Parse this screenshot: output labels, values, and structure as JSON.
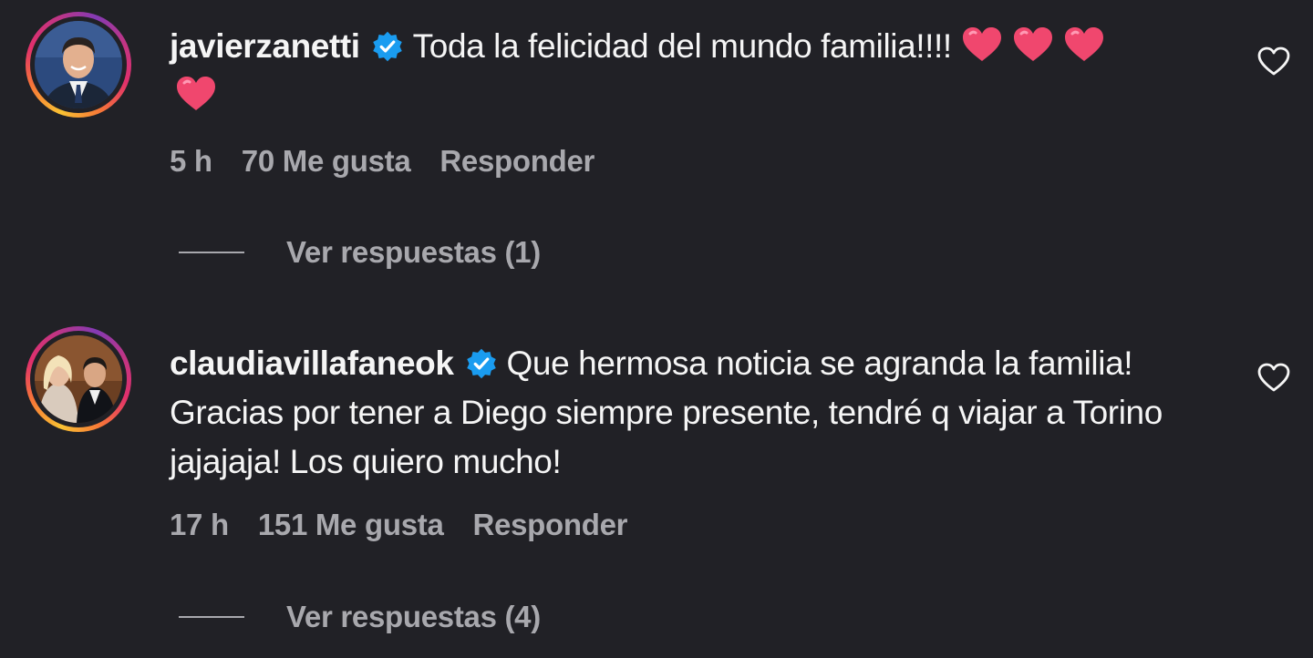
{
  "comments": [
    {
      "username": "javierzanetti",
      "text": "Toda la felicidad del mundo familia!!!!",
      "emoji_icons": [
        "heart-emoji",
        "heart-emoji",
        "heart-emoji",
        "heart-emoji"
      ],
      "time": "5 h",
      "likes": "70 Me gusta",
      "reply_label": "Responder",
      "view_replies": "Ver respuestas (1)",
      "avatar_icon": "avatar-photo-man-in-suit"
    },
    {
      "username": "claudiavillafaneok",
      "text": "Que hermosa noticia se agranda la familia! Gracias por tener a Diego siempre presente, tendré q viajar a Torino jajajaja! Los quiero mucho!",
      "time": "17 h",
      "likes": "151 Me gusta",
      "reply_label": "Responder",
      "view_replies": "Ver respuestas (4)",
      "avatar_icon": "avatar-photo-couple"
    }
  ],
  "icons": {
    "verified": "verified-badge-icon",
    "like": "heart-outline-icon"
  },
  "colors": {
    "background": "#212126",
    "text": "#f5f5f5",
    "secondary": "#a8a8ad",
    "verified": "#1a9cf0",
    "heart_emoji": "#f0476e"
  }
}
